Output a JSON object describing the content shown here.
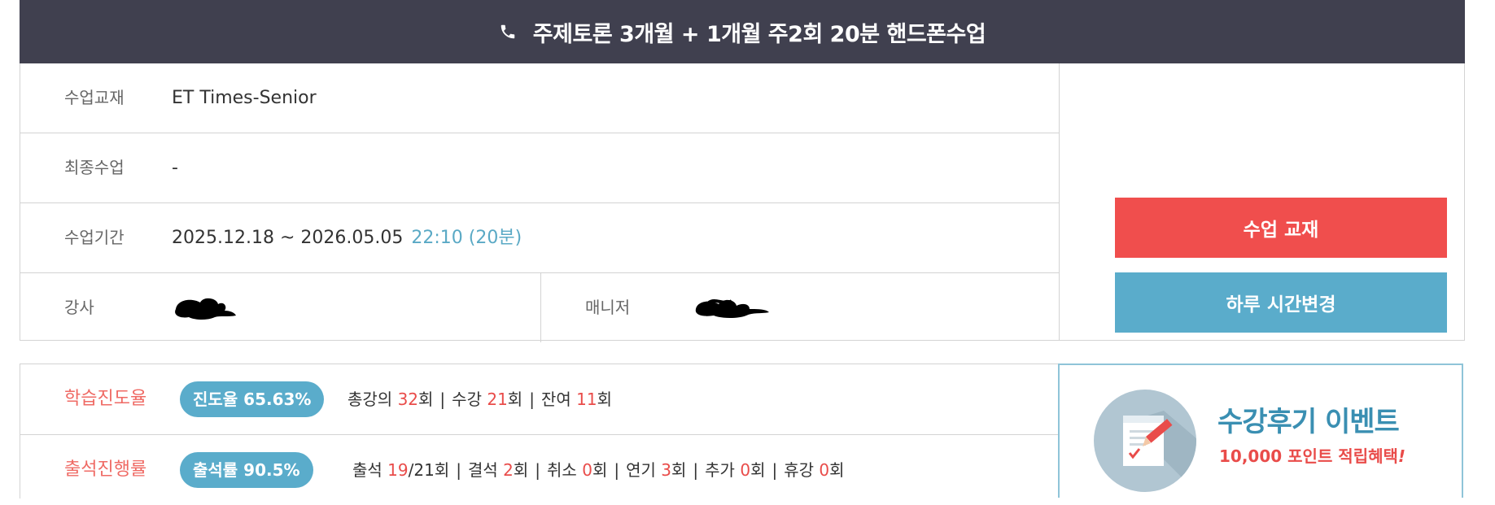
{
  "header": {
    "icon": "phone-icon",
    "title": "주제토론 3개월 + 1개월 주2회 20분 핸드폰수업",
    "bg_color": "#40404f"
  },
  "info": {
    "textbook": {
      "label": "수업교재",
      "value": "ET Times-Senior"
    },
    "last_class": {
      "label": "최종수업",
      "value": "-"
    },
    "period": {
      "label": "수업기간",
      "value": "2025.12.18 ~ 2026.05.05",
      "time": "22:10 (20분)"
    },
    "teacher": {
      "label": "강사"
    },
    "manager": {
      "label": "매니저"
    }
  },
  "buttons": {
    "textbook": {
      "label": "수업 교재",
      "color": "#f04e4d"
    },
    "change_time": {
      "label": "하루 시간변경",
      "color": "#5aaccb"
    }
  },
  "study_progress": {
    "label": "학습진도율",
    "pill": "진도율 65.63%",
    "total_label": "총강의",
    "total": "32",
    "attended_label": "수강",
    "attended": "21",
    "remaining_label": "잔여",
    "remaining": "11",
    "unit": "회"
  },
  "attendance": {
    "label": "출석진행률",
    "pill": "출석률 90.5%",
    "present_label": "출석",
    "present": "19",
    "present_total": "/21회",
    "absent_label": "결석",
    "absent": "2",
    "cancel_label": "취소",
    "cancel": "0",
    "postpone_label": "연기",
    "postpone": "3",
    "extra_label": "추가",
    "extra": "0",
    "break_label": "휴강",
    "break": "0",
    "unit": "회"
  },
  "event": {
    "icon": "review-document-icon",
    "title": "수강후기 이벤트",
    "subtitle": "10,000 포인트 적립혜택",
    "subtitle_mark": "!"
  }
}
